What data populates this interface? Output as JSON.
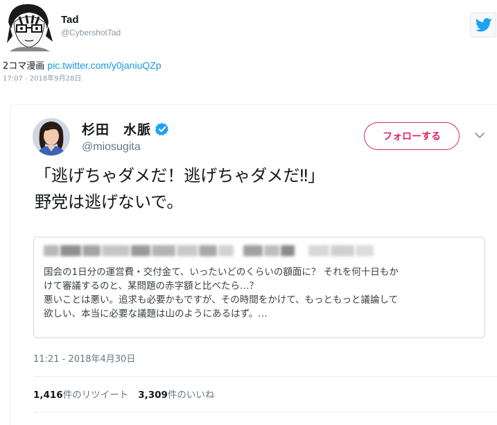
{
  "outer_tweet": {
    "author_name": "Tad",
    "author_handle": "@CybershotTad",
    "text_prefix": "2コマ漫画 ",
    "link_text": "pic.twitter.com/y0janiuQZp",
    "timestamp": "17:07 - 2018年9月28日",
    "brand_icon": "twitter-bird-icon",
    "brand_color": "#1da1f2",
    "link_color": "#1b95e0"
  },
  "embedded_tweet": {
    "author_name": "杉田　水脈",
    "author_handle": "@miosugita",
    "verified_icon": "verified-badge-icon",
    "verified_color": "#1da1f2",
    "follow_label": "フォローする",
    "follow_color": "#e0245e",
    "menu_icon": "chevron-down-icon",
    "text_lines": [
      "「逃げちゃダメだ！逃げちゃダメだ‼」",
      "野党は逃げないで。"
    ],
    "quote": {
      "lines": [
        "国会の1日分の運営費・交付金て、いったいどのくらいの額面に？ それを何十日もか",
        "けて審議するのと、某問題の赤字額と比べたら…？",
        "悪いことは悪い。追求も必要かもですが、その時間をかけて、もっともっと議論して",
        "欲しい、本当に必要な議題は山のようにあるはず。…"
      ]
    },
    "timestamp": "11:21 - 2018年4月30日",
    "stats": {
      "retweets_count": "1,416",
      "retweets_label": "件のリツイート",
      "likes_count": "3,309",
      "likes_label": "件のいいね"
    }
  }
}
